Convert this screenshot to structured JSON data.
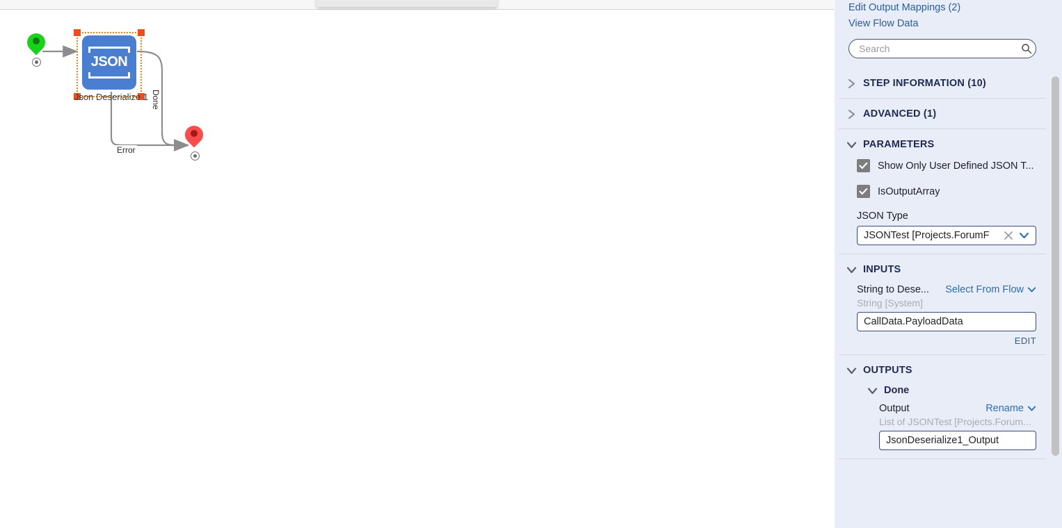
{
  "canvas": {
    "node": {
      "icon": "json-icon",
      "icon_text": "JSON",
      "label": "Json Deserialize 1"
    },
    "edges": [
      {
        "label": "Done"
      },
      {
        "label": "Error"
      }
    ],
    "pins": {
      "start": "start-pin",
      "end": "end-pin"
    }
  },
  "panel": {
    "links": [
      {
        "label": "Edit Output Mappings (2)"
      },
      {
        "label": "View Flow Data"
      }
    ],
    "search": {
      "placeholder": "Search",
      "value": "",
      "icon": "search-icon"
    },
    "sections": [
      {
        "key": "step_information",
        "title": "STEP INFORMATION (10)",
        "expanded": false
      },
      {
        "key": "advanced",
        "title": "ADVANCED (1)",
        "expanded": false
      },
      {
        "key": "parameters",
        "title": "PARAMETERS",
        "expanded": true
      },
      {
        "key": "inputs",
        "title": "INPUTS",
        "expanded": true
      },
      {
        "key": "outputs",
        "title": "OUTPUTS",
        "expanded": true
      }
    ],
    "parameters": {
      "checkboxes": [
        {
          "label": "Show Only User Defined JSON T...",
          "checked": true
        },
        {
          "label": "IsOutputArray",
          "checked": true
        }
      ],
      "json_type": {
        "label": "JSON Type",
        "value": "JSONTest  [Projects.ForumF",
        "clear_icon": "close-icon",
        "dropdown_icon": "chevron-down-icon"
      }
    },
    "inputs": {
      "field_label": "String to Dese...",
      "select_link": "Select From Flow",
      "select_link_icon": "chevron-down-icon",
      "type_hint": "String [System]",
      "value": "CallData.PayloadData",
      "edit_label": "EDIT"
    },
    "outputs": {
      "group_title": "Done",
      "field_label": "Output",
      "rename_link": "Rename",
      "rename_icon": "chevron-down-icon",
      "type_hint": "List of JSONTest [Projects.Forum...",
      "value": "JsonDeserialize1_Output"
    }
  },
  "colors": {
    "panel_bg": "#e9edf7",
    "link_blue": "#2a5d9e",
    "section_title": "#1f2a52",
    "node_blue": "#4a7ed0",
    "selection_orange": "#e8820c",
    "handle_orange": "#e8501e",
    "start_pin_green": "#18d419",
    "end_pin_red": "#fc4b4b",
    "checkbox_gray": "#7d7d7d"
  }
}
